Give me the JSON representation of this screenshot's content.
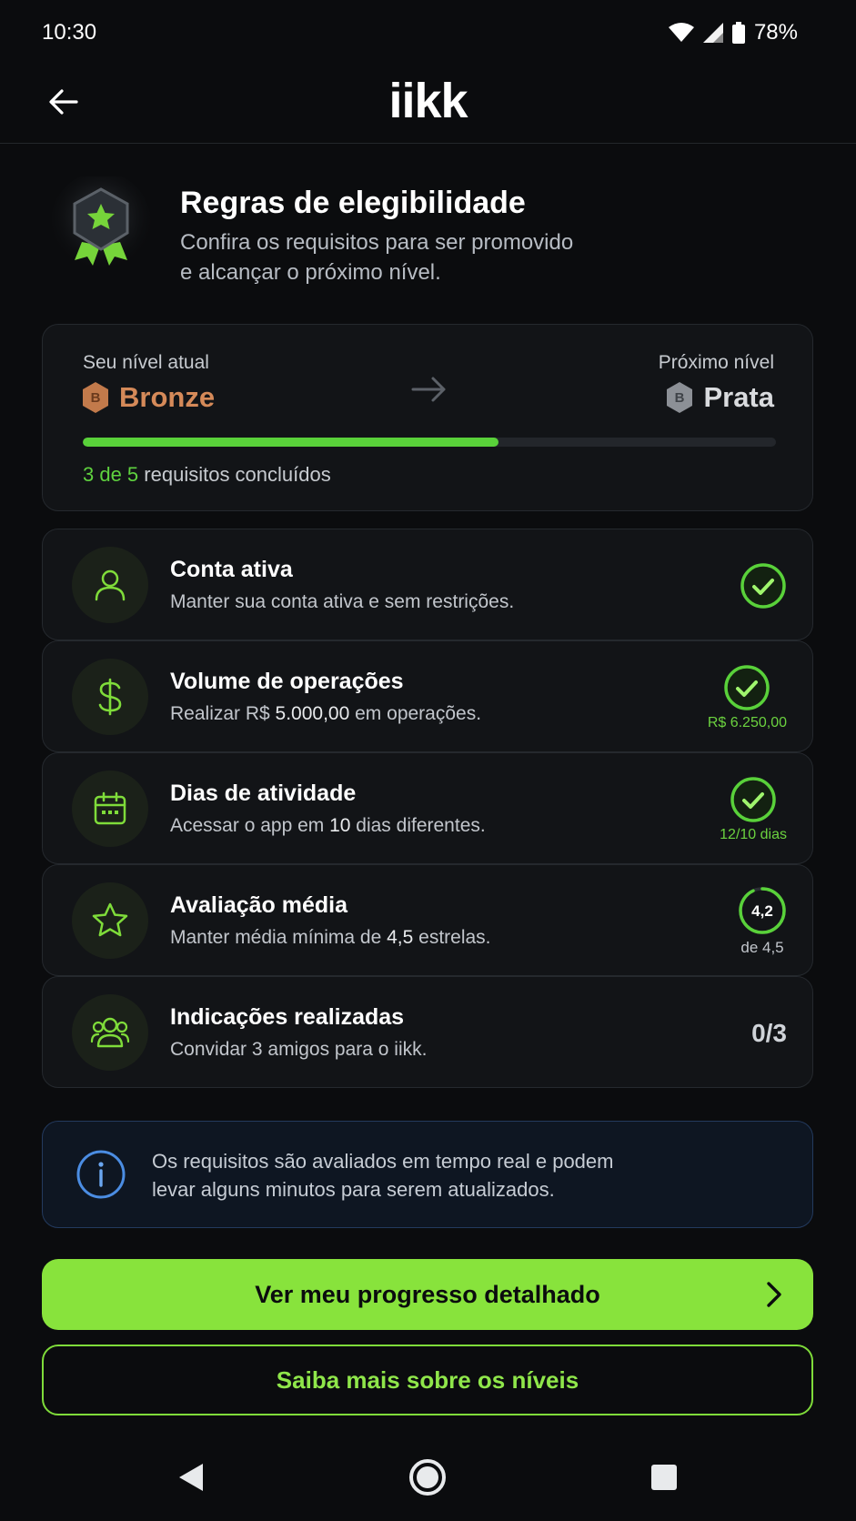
{
  "status_bar": {
    "time": "10:30",
    "battery": "78%"
  },
  "app_bar": {
    "logo": "iikk",
    "icons": {
      "back": "arrow-left-icon"
    }
  },
  "hero": {
    "title": "Regras de elegibilidade",
    "subtitle_line1": "Confira os requisitos para ser promovido",
    "subtitle_line2": "e alcançar o próximo nível.",
    "icon": "award-badge-icon"
  },
  "level_card": {
    "current_label": "Seu nível atual",
    "current_level": "Bronze",
    "current_badge_letter": "B",
    "next_label": "Próximo nível",
    "next_level": "Prata",
    "next_badge_letter": "B",
    "progress_fraction": 0.6,
    "progress_done": "3 de 5",
    "progress_suffix": " requisitos concluídos",
    "colors": {
      "bronze": "#d58a59",
      "progress": "#59d13a"
    }
  },
  "requirements": [
    {
      "title": "Conta ativa",
      "desc": "Manter sua conta ativa e sem restrições.",
      "icon": "user-icon",
      "status": "done"
    },
    {
      "title": "Volume de operações",
      "desc_pre": "Realizar R$ ",
      "desc_bold": "5.000,00",
      "desc_post": " em operações.",
      "icon": "dollar-icon",
      "status": "done",
      "value": "R$ 6.250,00"
    },
    {
      "title": "Dias de atividade",
      "desc_pre": "Acessar o app em ",
      "desc_bold": "10",
      "desc_post": " dias diferentes.",
      "icon": "calendar-icon",
      "status": "done",
      "value": "12/10 dias"
    },
    {
      "title": "Avaliação média",
      "desc_pre": "Manter média mínima de ",
      "desc_bold": "4,5",
      "desc_post": " estrelas.",
      "icon": "star-icon",
      "status": "in-progress",
      "ring_value": "4,2",
      "ring_fraction": 0.93,
      "target": "de 4,5"
    },
    {
      "title": "Indicações realizadas",
      "desc": "Convidar 3 amigos para o iikk.",
      "icon": "users-icon",
      "status": "pending",
      "count": "0/3"
    }
  ],
  "info": {
    "text_line1": "Os requisitos são avaliados em tempo real e podem",
    "text_line2": "levar alguns minutos para serem atualizados.",
    "icon": "info-icon"
  },
  "buttons": {
    "primary": "Ver meu progresso detalhado",
    "secondary": "Saiba mais sobre os níveis"
  },
  "colors": {
    "accent": "#88e33c",
    "background": "#0b0c0e",
    "card": "#121417",
    "info_border": "#233a5e"
  }
}
